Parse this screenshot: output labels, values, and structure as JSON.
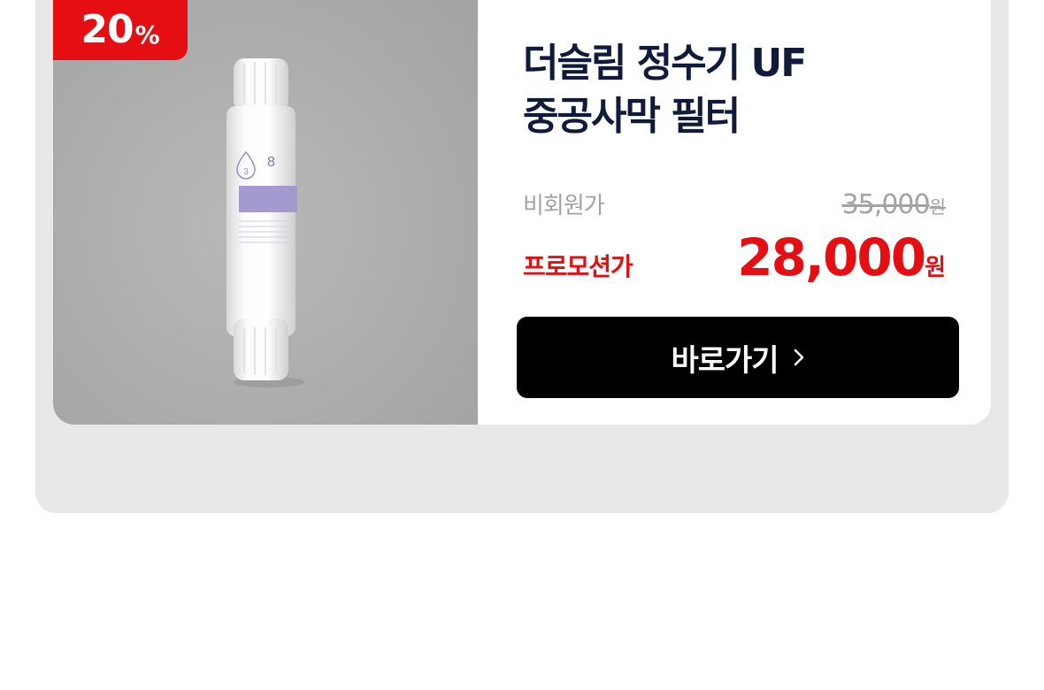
{
  "discount": {
    "number": "20",
    "unit": "%"
  },
  "product": {
    "title": "더슬림 정수기 UF\n중공사막 필터",
    "image_icon": "water-filter-cartridge-image",
    "cartridge_number": "8",
    "cartridge_stage": "3"
  },
  "pricing": {
    "regular_label": "비회원가",
    "regular_value": "35,000",
    "regular_unit": "원",
    "promo_label": "프로모션가",
    "promo_value": "28,000",
    "promo_unit": "원"
  },
  "cta": {
    "label": "바로가기",
    "icon": "chevron-right-icon"
  },
  "colors": {
    "accent": "#e50e12",
    "title": "#101a3a",
    "button": "#000000",
    "muted": "#a3a3a3",
    "background": "#e8e8e8"
  }
}
